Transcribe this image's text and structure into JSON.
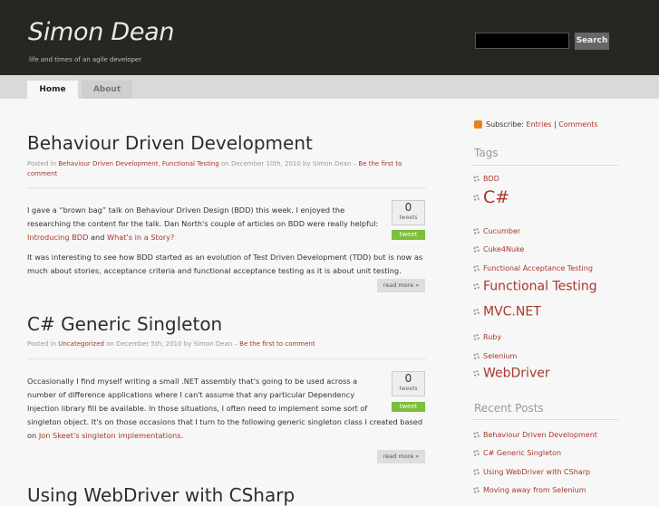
{
  "site": {
    "title": "Simon Dean",
    "tagline": "life and times of an agile developer"
  },
  "search": {
    "button": "Search",
    "value": ""
  },
  "nav": {
    "home": "Home",
    "about": "About"
  },
  "posts": [
    {
      "title": "Behaviour Driven Development",
      "meta_posted_in": "Posted in",
      "cat1": "Behaviour Driven Development",
      "sep": ",",
      "cat2": "Functional Testing",
      "meta_date": "on December 10th, 2010 by Simon Dean –",
      "comments": "Be the first to comment",
      "p1_a": "I gave a “brown bag” talk on Behaviour Driven Design (BDD) this week.   I enjoyed the",
      "p1_b": "researching the content for the talk. Dan North's couple of articles on BDD were really helpful:",
      "link1": "Introducing BDD",
      "and": "and",
      "link2": "What's in a Story?",
      "p2_a": "It was interesting to see how BDD started as an evolution of Test Driven Development (TDD) but is now as",
      "p2_b": "much about stories, acceptance criteria and functional acceptance testing as it is about unit testing.",
      "tweets": "0",
      "tweets_label": "tweets",
      "tweet_btn": "tweet",
      "readmore": "read more »"
    },
    {
      "title": "C# Generic Singleton",
      "meta_posted_in": "Posted in",
      "cat1": "Uncategorized",
      "meta_date": "on December 5th, 2010 by Simon Dean –",
      "comments": "Be the first to comment",
      "p1_a": "Occasionally I find myself writing a small .NET assembly that's going to be used across a",
      "p1_b": "number of difference applications where I can't assume that any particular Dependency",
      "p1_c": "Injection library fill be available.   In those situations, I often need to implement some sort of",
      "p1_d": "singleton object.  It's on those occasions that I turn to the following generic singleton class I created based",
      "on": "on",
      "link1": "Jon Skeet's singleton implementations",
      "dot": ".",
      "tweets": "0",
      "tweets_label": "tweets",
      "tweet_btn": "tweet",
      "readmore": "read more »"
    },
    {
      "title": "Using WebDriver with CSharp"
    }
  ],
  "sidebar": {
    "subscribe": "Subscribe:",
    "entries": "Entries",
    "bar": "|",
    "comments": "Comments",
    "tags_heading": "Tags",
    "tags": [
      "BDD",
      "C#",
      "Cucumber",
      "Cuke4Nuke",
      "Functional Acceptance Testing",
      "Functional Testing",
      "MVC.NET",
      "Ruby",
      "Selenium",
      "WebDriver"
    ],
    "recent_heading": "Recent Posts",
    "recent": [
      "Behaviour Driven Development",
      "C# Generic Singleton",
      "Using WebDriver with CSharp",
      "Moving away from Selenium"
    ]
  }
}
